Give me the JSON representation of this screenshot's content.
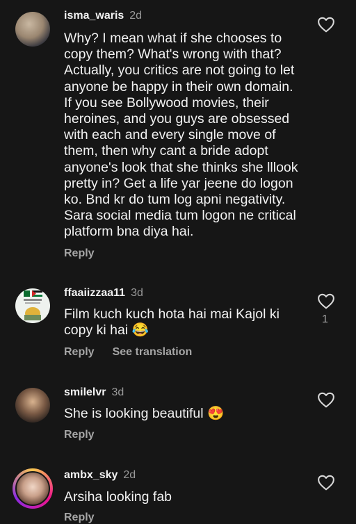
{
  "comments": [
    {
      "username": "isma_waris",
      "time": "2d",
      "text": "Why? I mean what if she chooses to\ncopy them? What's wrong with that?\nActually, you critics are not going to let\nanyone be happy in their own domain.\nIf you see Bollywood movies, their\nheroines, and you guys are obsessed\nwith each and every single move of\nthem, then why cant a bride adopt\nanyone's look that she thinks she lllook\npretty in? Get a life yar jeene do logon\nko. Bnd kr do tum log apni negativity.\nSara social media tum logon ne critical\nplatform bna diya hai.",
      "reply_label": "Reply"
    },
    {
      "username": "ffaaiizzaa11",
      "time": "3d",
      "text": "Film kuch kuch hota hai mai Kajol ki\ncopy ki hai 😂",
      "reply_label": "Reply",
      "translation_label": "See translation",
      "like_count": "1"
    },
    {
      "username": "smilelvr",
      "time": "3d",
      "text": "She is looking beautiful 😍",
      "reply_label": "Reply"
    },
    {
      "username": "ambx_sky",
      "time": "2d",
      "text": "Arsiha looking fab",
      "reply_label": "Reply"
    }
  ]
}
